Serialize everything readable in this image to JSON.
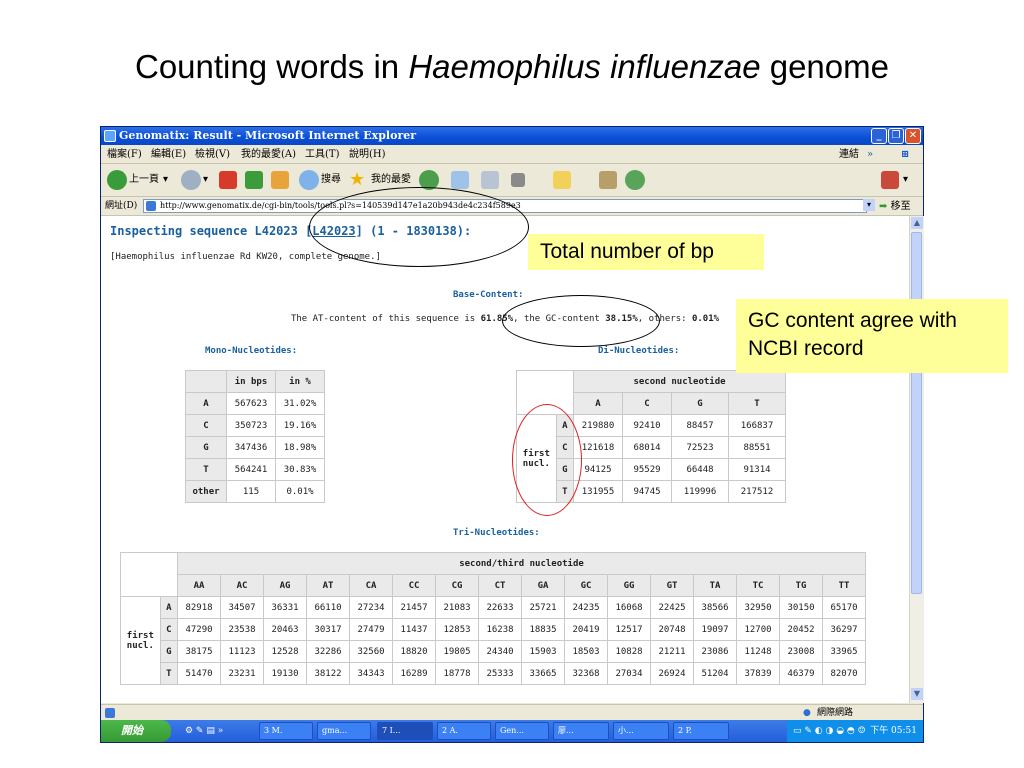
{
  "slide": {
    "title_pre": "Counting words in ",
    "title_italic": "Haemophilus influenzae",
    "title_post": " genome"
  },
  "browser": {
    "window_title": "Genomatix: Result - Microsoft Internet Explorer",
    "menu": [
      "檔案(F)",
      "編輯(E)",
      "檢視(V)",
      "我的最愛(A)",
      "工具(T)",
      "說明(H)"
    ],
    "links_label": "連結",
    "back_label": "上一頁",
    "search_label": "搜尋",
    "favorites_label": "我的最愛",
    "address_label": "網址(D)",
    "address_url": "http://www.genomatix.de/cgi-bin/tools/tools.pl?s=140539d147e1a20b943de4c234f589e3",
    "go_label": "移至",
    "status_zone": "網際網路"
  },
  "taskbar": {
    "start_label": "開始",
    "items": [
      "3 M.",
      "gma...",
      "7 I...",
      "2 A.",
      "Gen...",
      "廖...",
      "小...",
      "2 P."
    ],
    "clock": "下午 05:51"
  },
  "page": {
    "heading_pre": "Inspecting sequence L42023 [",
    "heading_link": "L42023",
    "heading_post": "] (1 - 1830138):",
    "subtitle": "[Haemophilus influenzae Rd KW20, complete genome.]",
    "base_content_label": "Base-Content:",
    "at_pre": "The AT-content of this sequence is ",
    "at_value": "61.85%",
    "gc_pre": ", the GC-content ",
    "gc_value": "38.15%",
    "others_pre": ", others: ",
    "others_value": "0.01%",
    "mono_label": "Mono-Nucleotides:",
    "di_label": "Di-Nucleotides:",
    "tri_label": "Tri-Nucleotides:"
  },
  "mono": {
    "headers": [
      "",
      "in bps",
      "in %"
    ],
    "rows": [
      [
        "A",
        "567623",
        "31.02%"
      ],
      [
        "C",
        "350723",
        "19.16%"
      ],
      [
        "G",
        "347436",
        "18.98%"
      ],
      [
        "T",
        "564241",
        "30.83%"
      ],
      [
        "other",
        "115",
        "0.01%"
      ]
    ]
  },
  "di": {
    "col_group": "second nucleotide",
    "row_group": "first nucl.",
    "cols": [
      "A",
      "C",
      "G",
      "T"
    ],
    "rows": [
      {
        "label": "A",
        "values": [
          "219880",
          "92410",
          "88457",
          "166837"
        ]
      },
      {
        "label": "C",
        "values": [
          "121618",
          "68014",
          "72523",
          "88551"
        ]
      },
      {
        "label": "G",
        "values": [
          "94125",
          "95529",
          "66448",
          "91314"
        ]
      },
      {
        "label": "T",
        "values": [
          "131955",
          "94745",
          "119996",
          "217512"
        ]
      }
    ]
  },
  "tri": {
    "col_group": "second/third nucleotide",
    "row_group": "first nucl.",
    "cols": [
      "AA",
      "AC",
      "AG",
      "AT",
      "CA",
      "CC",
      "CG",
      "CT",
      "GA",
      "GC",
      "GG",
      "GT",
      "TA",
      "TC",
      "TG",
      "TT"
    ],
    "rows": [
      {
        "label": "A",
        "values": [
          "82918",
          "34507",
          "36331",
          "66110",
          "27234",
          "21457",
          "21083",
          "22633",
          "25721",
          "24235",
          "16068",
          "22425",
          "38566",
          "32950",
          "30150",
          "65170"
        ]
      },
      {
        "label": "C",
        "values": [
          "47290",
          "23538",
          "20463",
          "30317",
          "27479",
          "11437",
          "12853",
          "16238",
          "18835",
          "20419",
          "12517",
          "20748",
          "19097",
          "12700",
          "20452",
          "36297"
        ]
      },
      {
        "label": "G",
        "values": [
          "38175",
          "11123",
          "12528",
          "32286",
          "32560",
          "18820",
          "19805",
          "24340",
          "15903",
          "18503",
          "10828",
          "21211",
          "23086",
          "11248",
          "23008",
          "33965"
        ]
      },
      {
        "label": "T",
        "values": [
          "51470",
          "23231",
          "19130",
          "38122",
          "34343",
          "16289",
          "18778",
          "25333",
          "33665",
          "32368",
          "27034",
          "26924",
          "51204",
          "37839",
          "46379",
          "82070"
        ]
      }
    ]
  },
  "callouts": {
    "total_bp": "Total number of bp",
    "gc_agree_line1": "GC content agree with",
    "gc_agree_line2": "NCBI record"
  }
}
